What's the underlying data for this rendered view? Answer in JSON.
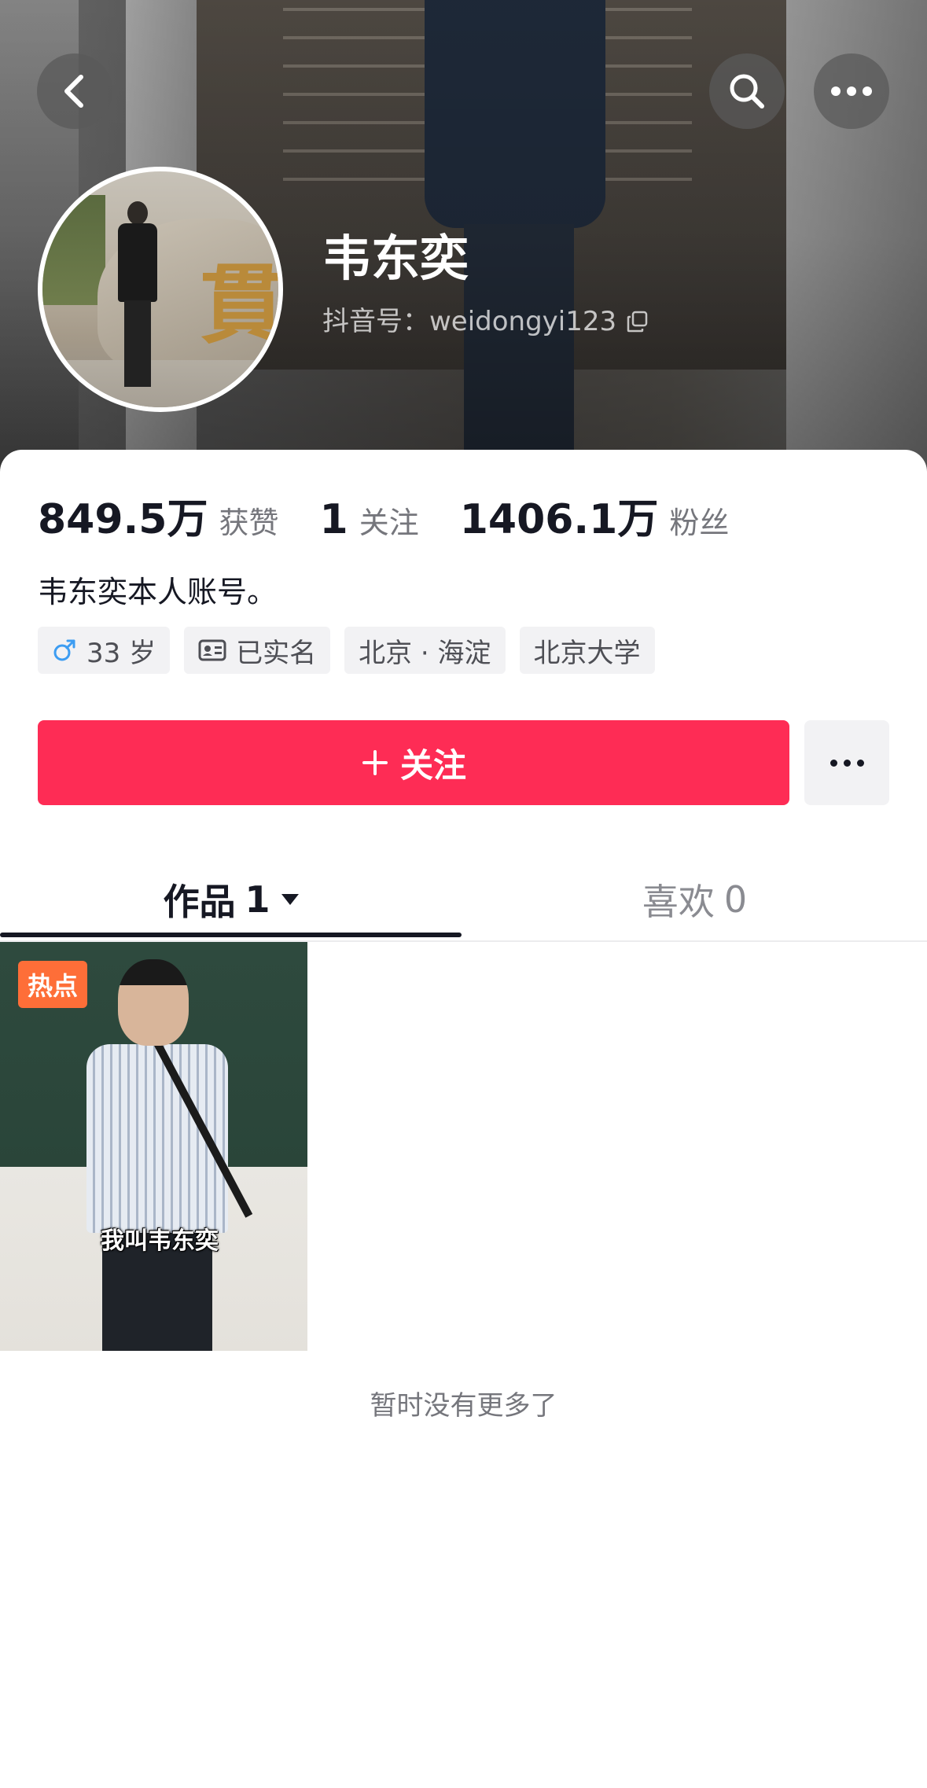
{
  "profile": {
    "name": "韦东奕",
    "douyin_id": "抖音号：weidongyi123",
    "bio": "韦东奕本人账号。"
  },
  "stats": [
    {
      "value": "849.5万",
      "label": "获赞"
    },
    {
      "value": "1",
      "label": "关注"
    },
    {
      "value": "1406.1万",
      "label": "粉丝"
    }
  ],
  "tags": [
    {
      "icon": "male-icon",
      "label": "33 岁"
    },
    {
      "icon": "id-card-icon",
      "label": "已实名"
    },
    {
      "icon": "",
      "label": "北京 · 海淀"
    },
    {
      "icon": "",
      "label": "北京大学"
    }
  ],
  "actions": {
    "follow_label": "关注",
    "follow_icon": "plus-icon"
  },
  "tabs": {
    "works": {
      "label": "作品",
      "count": "1"
    },
    "likes": {
      "label": "喜欢",
      "count": "0"
    }
  },
  "videos": [
    {
      "badge": "热点",
      "caption": "我叫韦东奕"
    }
  ],
  "footer": {
    "no_more": "暂时没有更多了"
  },
  "colors": {
    "accent": "#fe2c55",
    "hot_badge": "#fe6e38",
    "primary_text": "#161823",
    "secondary_text": "#75767c",
    "tag_bg": "#f2f2f4"
  }
}
